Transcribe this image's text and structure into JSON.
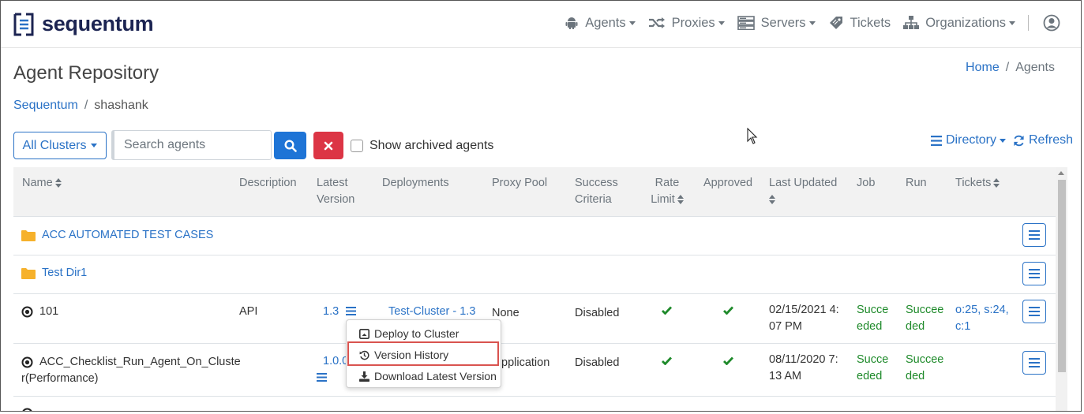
{
  "app": {
    "brand": "sequentum",
    "brand_color": "#1c2452",
    "accent": "#2a72c6"
  },
  "nav": {
    "agents": "Agents",
    "proxies": "Proxies",
    "servers": "Servers",
    "tickets": "Tickets",
    "organizations": "Organizations"
  },
  "page": {
    "title": "Agent Repository",
    "crumb_home": "Home",
    "crumb_sep": "/",
    "crumb_current": "Agents",
    "sub_crumb_root": "Sequentum",
    "sub_crumb_current": "shashank"
  },
  "toolbar": {
    "clusters_label": "All Clusters",
    "search_placeholder": "Search agents",
    "archived_label": "Show archived agents",
    "directory_label": "Directory",
    "refresh_label": "Refresh"
  },
  "table": {
    "headers": {
      "name": "Name",
      "description": "Description",
      "latest_version_1": "Latest",
      "latest_version_2": "Version",
      "deployments": "Deployments",
      "proxy_pool": "Proxy Pool",
      "success_1": "Success",
      "success_2": "Criteria",
      "rate_1": "Rate",
      "rate_2": "Limit",
      "approved": "Approved",
      "last_updated": "Last Updated",
      "job": "Job",
      "run": "Run",
      "tickets": "Tickets"
    },
    "folders": [
      {
        "name": "ACC AUTOMATED TEST CASES"
      },
      {
        "name": "Test Dir1"
      }
    ],
    "rows": [
      {
        "name": "101",
        "description": "API",
        "version": "1.3",
        "deployment": "Test-Cluster - 1.3",
        "proxy_pool": "None",
        "success": "Disabled",
        "updated_1": "02/15/2021 4:",
        "updated_2": "07 PM",
        "job_1": "Succe",
        "job_2": "eded",
        "run_1": "Succee",
        "run_2": "ded",
        "tickets_1": "o:25, s:24,",
        "tickets_2": "c:1"
      },
      {
        "name_1": "ACC_Checklist_Run_Agent_On_Cluste",
        "name_2": "r(Performance)",
        "version": "1.0.0",
        "proxy_pool_partial": "pplication",
        "success": "Disabled",
        "updated_1": "08/11/2020 7:",
        "updated_2": "13 AM",
        "job_1": "Succe",
        "job_2": "eded",
        "run_1": "Succee",
        "run_2": "ded"
      }
    ]
  },
  "dropdown": {
    "deploy": "Deploy to Cluster",
    "history": "Version History",
    "download": "Download Latest Version"
  },
  "colors": {
    "success_green": "#1e8a2a",
    "danger": "#dc3545",
    "primary": "#1e74d6",
    "folder": "#f6b12b"
  }
}
